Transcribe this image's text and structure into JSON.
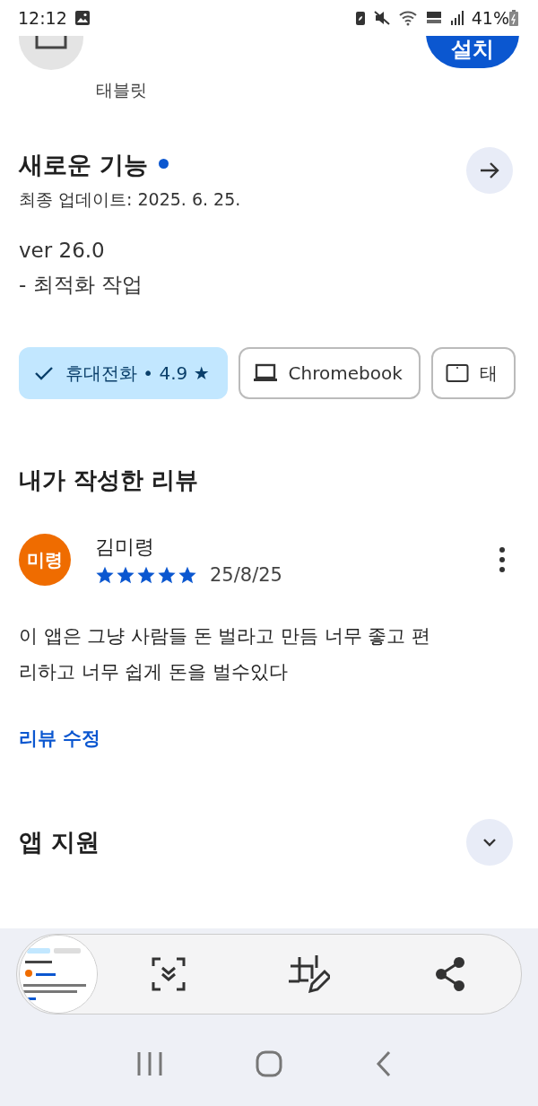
{
  "status_bar": {
    "time": "12:12",
    "battery": "41%"
  },
  "app_header": {
    "subtitle": "태블릿",
    "install_button": "설치"
  },
  "whats_new": {
    "title": "새로운 기능",
    "unread": true,
    "updated": "최종 업데이트: 2025. 6. 25.",
    "lines": [
      "ver 26.0",
      "- 최적화 작업"
    ]
  },
  "device_chips": [
    {
      "kind": "phone",
      "label": "휴대전화 • 4.9 ★",
      "selected": true
    },
    {
      "kind": "laptop",
      "label": "Chromebook",
      "selected": false
    },
    {
      "kind": "tablet",
      "label": "태",
      "selected": false
    }
  ],
  "my_review": {
    "title": "내가 작성한 리뷰",
    "avatar_initials": "미령",
    "author": "김미령",
    "stars": 5,
    "date": "25/8/25",
    "text": "이 앱은 그냥 사람들 돈 벌라고 만듬 너무 좋고 편리하고 너무 쉽게 돈을 벌수있다",
    "edit_link": "리뷰 수정"
  },
  "app_support": {
    "title": "앱 지원",
    "expanded": false
  }
}
